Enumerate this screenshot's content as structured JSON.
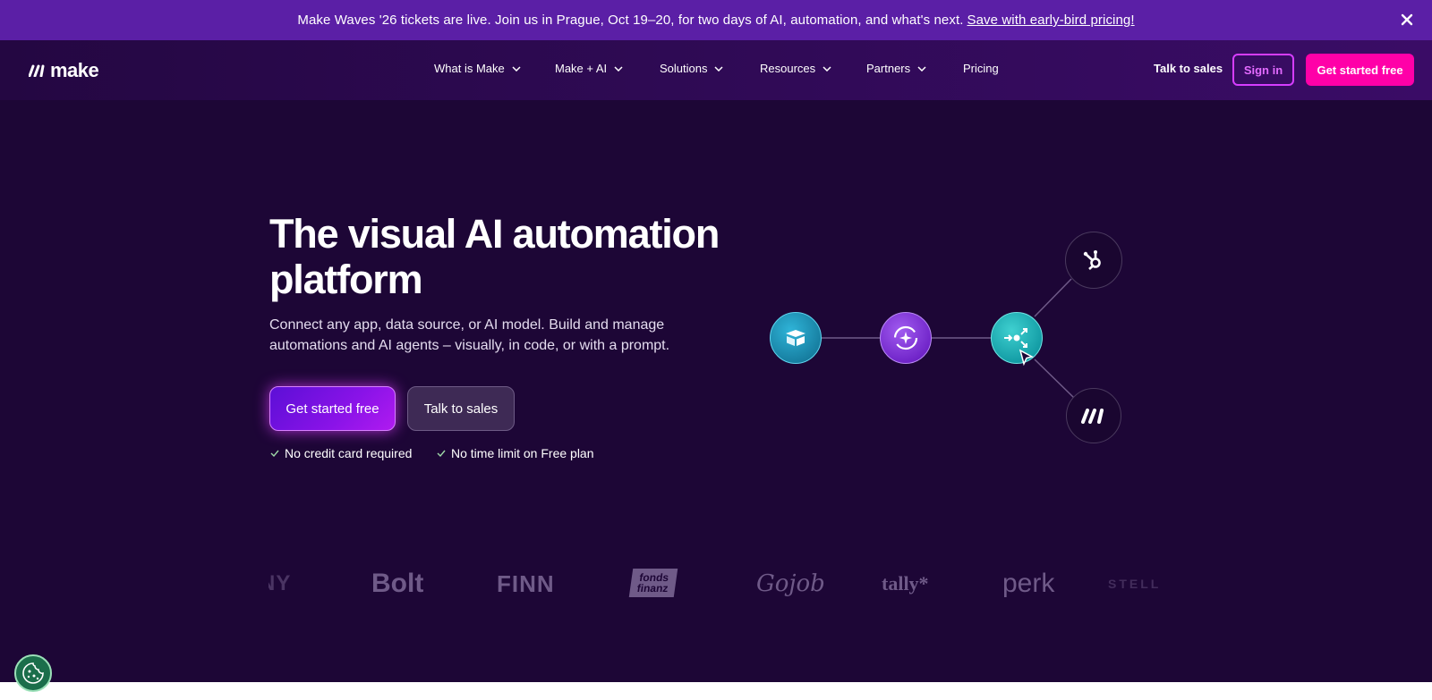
{
  "banner": {
    "message": "Make Waves '26 tickets are live. Join us in Prague, Oct 19–20, for two days of AI, automation, and what's next.",
    "link_label": "Save with early-bird pricing!",
    "close_icon": "close-icon"
  },
  "nav": {
    "logo_text": "make",
    "items": [
      {
        "label": "What is Make",
        "has_dropdown": true
      },
      {
        "label": "Make + AI",
        "has_dropdown": true
      },
      {
        "label": "Solutions",
        "has_dropdown": true
      },
      {
        "label": "Resources",
        "has_dropdown": true
      },
      {
        "label": "Partners",
        "has_dropdown": true
      },
      {
        "label": "Pricing",
        "has_dropdown": false
      }
    ],
    "talk_to_sales": "Talk to sales",
    "sign_in": "Sign in",
    "get_started": "Get started free"
  },
  "hero": {
    "title_line1": "The visual AI automation",
    "title_line2": "platform",
    "subtitle": "Connect any app, data source, or AI model. Build and manage automations and AI agents – visually, in code, or with a prompt.",
    "primary_button": "Get started free",
    "secondary_button": "Talk to sales",
    "checks": [
      "No credit card required",
      "No time limit on Free plan"
    ]
  },
  "diagram": {
    "nodes": [
      "airtable-icon",
      "ai-sparkle-icon",
      "router-icon",
      "hubspot-icon",
      "make-logo-icon"
    ]
  },
  "logos": {
    "items": [
      "NY",
      "Bolt",
      "FINN",
      "fonds finanz",
      "Gojob",
      "tally*",
      "perk",
      "STELL"
    ]
  },
  "colors": {
    "background": "#1d0636",
    "banner": "#5b1fa6",
    "accent_pink": "#ff00a8",
    "accent_purple": "#d63dff"
  },
  "cookie": {
    "icon": "cookie-icon"
  }
}
